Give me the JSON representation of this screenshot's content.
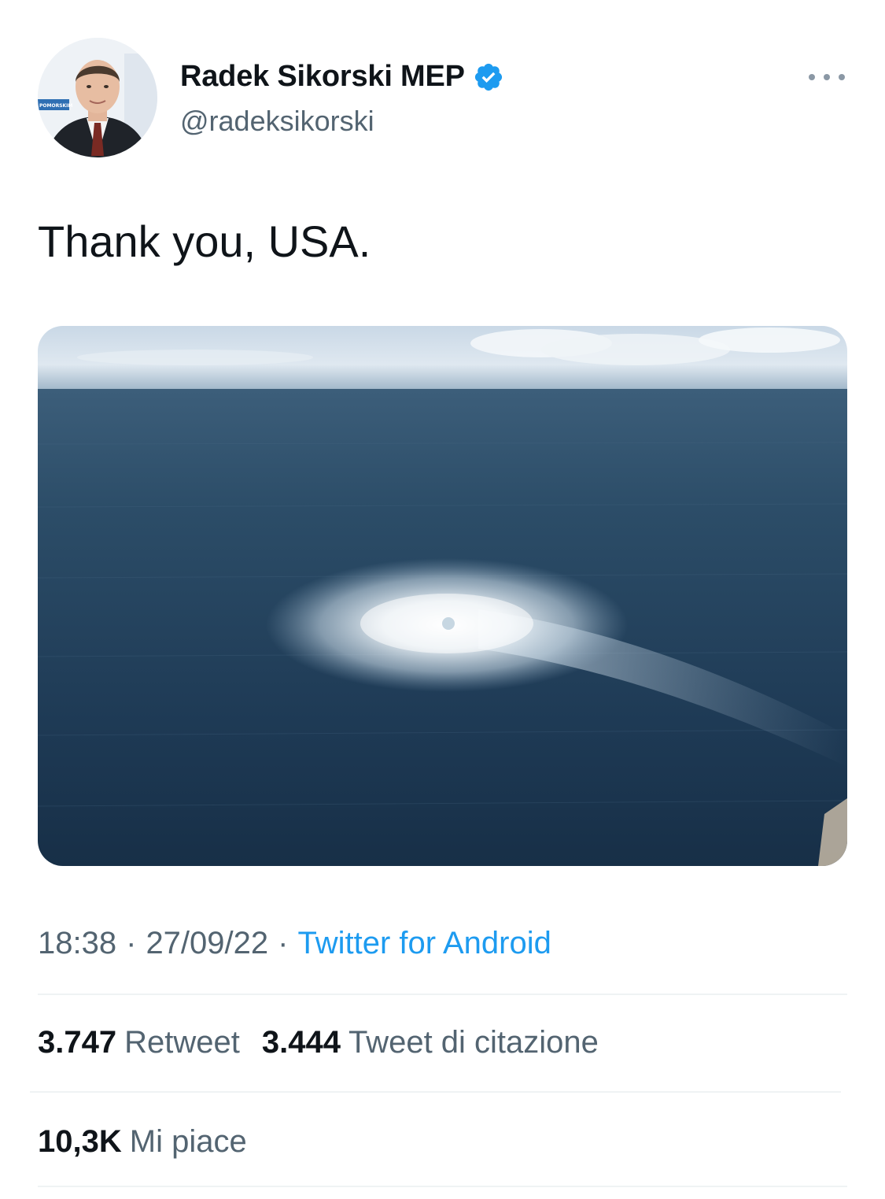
{
  "author": {
    "display_name": "Radek Sikorski MEP",
    "handle": "@radeksikorski",
    "verified": true,
    "avatar_icon": "profile-photo",
    "avatar_backdrop_text": "POMORSKIM"
  },
  "tweet": {
    "text": "Thank you, USA.",
    "media_alt": "aerial-photo-sea-gas-bubbles"
  },
  "meta": {
    "time": "18:38",
    "separator": "·",
    "date": "27/09/22",
    "source": "Twitter for Android"
  },
  "stats": {
    "retweets_count": "3.747",
    "retweets_label": "Retweet",
    "quotes_count": "3.444",
    "quotes_label": "Tweet di citazione",
    "likes_count": "10,3K",
    "likes_label": "Mi piace"
  },
  "colors": {
    "text_primary": "#0f1419",
    "text_secondary": "#536471",
    "accent": "#1d9bf0",
    "divider": "#eff3f4"
  },
  "icons": {
    "more": "more-horizontal-icon",
    "verified": "verified-badge-icon"
  }
}
